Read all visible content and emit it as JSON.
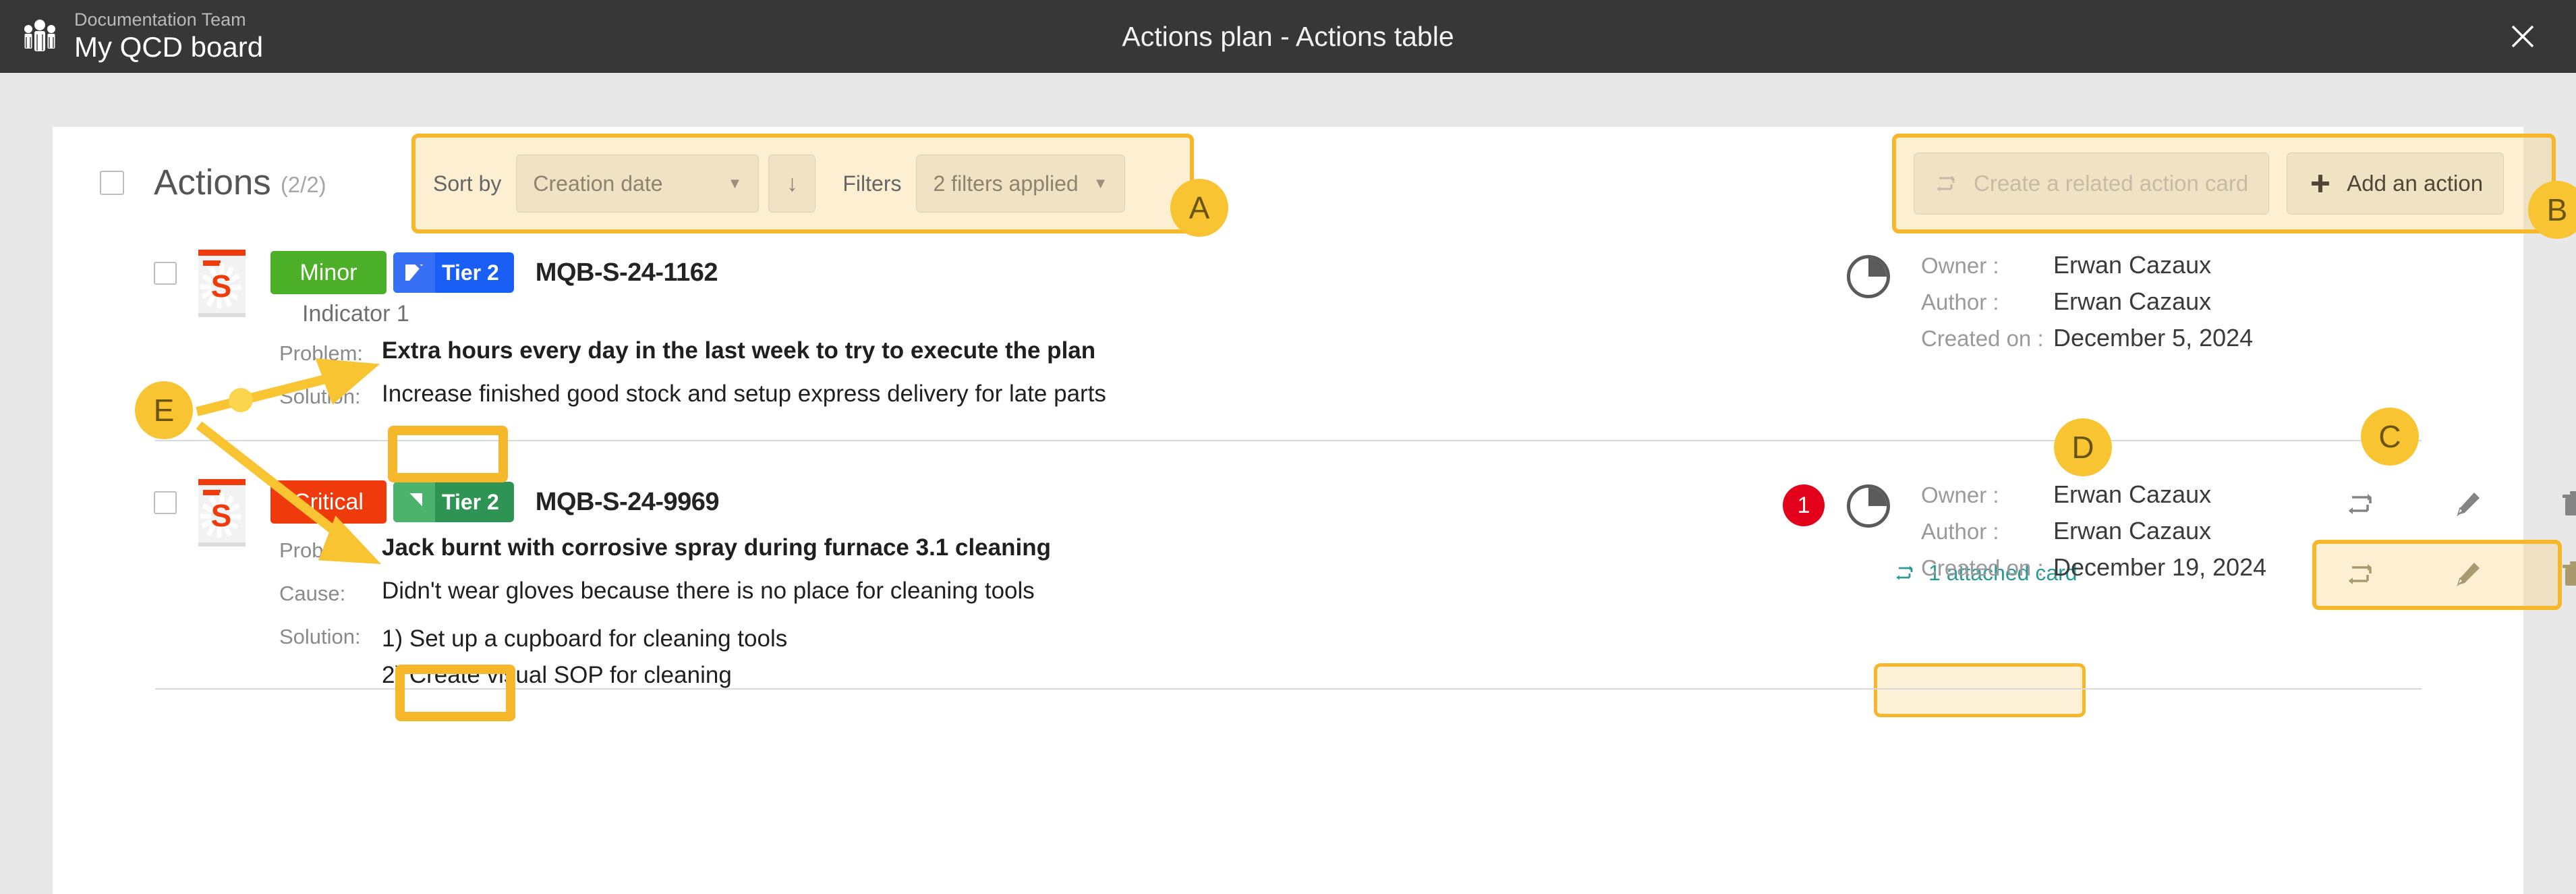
{
  "titlebar": {
    "team": "Documentation Team",
    "board": "My QCD board",
    "window_title": "Actions plan - Actions table",
    "close_icon": "close-icon",
    "brand_icon": "team-group-icon"
  },
  "toolbar": {
    "checkbox_checked": false,
    "heading": "Actions",
    "count": "(2/2)",
    "sort_label": "Sort by",
    "sort_value": "Creation date",
    "sort_direction_icon": "arrow-down-icon",
    "filters_label": "Filters",
    "filters_value": "2 filters applied",
    "create_related_label": "Create a related action card",
    "create_related_icon": "loop-card-icon",
    "add_action_label": "Add an action",
    "add_action_icon": "plus-icon"
  },
  "annotations": {
    "a": "A",
    "b": "B",
    "c": "C",
    "d": "D",
    "e": "E",
    "color": "#f9c432"
  },
  "rows": [
    {
      "card_letter": "S",
      "severity": "Minor",
      "severity_color": "#4caf28",
      "tier": "Tier 2",
      "tier_color": "#1a5ff5",
      "tier_icon": "tier-flag-blue-icon",
      "reference": "MQB-S-24-1162",
      "indicator": "Indicator 1",
      "fields": [
        {
          "label": "Problem:",
          "value": "Extra hours every day in the last week to try to execute the plan",
          "bold": true
        },
        {
          "label": "Solution:",
          "value": "Increase finished good stock and setup express delivery for late parts",
          "bold": false
        }
      ],
      "owner_label": "Owner :",
      "owner": "Erwan Cazaux",
      "author_label": "Author :",
      "author": "Erwan Cazaux",
      "created_label": "Created on :",
      "created": "December 5, 2024",
      "attached_card_label": "1 attached card",
      "attached_card_icon": "loop-card-icon",
      "alert_count": null,
      "icons": [
        "loop-card-icon",
        "pencil-icon",
        "trash-icon"
      ]
    },
    {
      "card_letter": "S",
      "severity": "Critical",
      "severity_color": "#ef3b0c",
      "tier": "Tier 2",
      "tier_color": "#34a25c",
      "tier_icon": "tier-flag-green-icon",
      "reference": "MQB-S-24-9969",
      "indicator": null,
      "fields": [
        {
          "label": "Problem:",
          "value": "Jack burnt with corrosive spray during furnace 3.1 cleaning",
          "bold": true
        },
        {
          "label": "Cause:",
          "value": "Didn't wear gloves because there is no place for cleaning tools",
          "bold": false
        },
        {
          "label": "Solution:",
          "value": "1) Set up a cupboard for cleaning tools\n2) Create visual SOP for cleaning",
          "bold": false
        }
      ],
      "owner_label": "Owner :",
      "owner": "Erwan Cazaux",
      "author_label": "Author :",
      "author": "Erwan Cazaux",
      "created_label": "Created on :",
      "created": "December 19, 2024",
      "attached_card_label": null,
      "alert_count": "1",
      "icons": [
        "loop-card-icon",
        "pencil-icon",
        "trash-icon"
      ]
    }
  ]
}
